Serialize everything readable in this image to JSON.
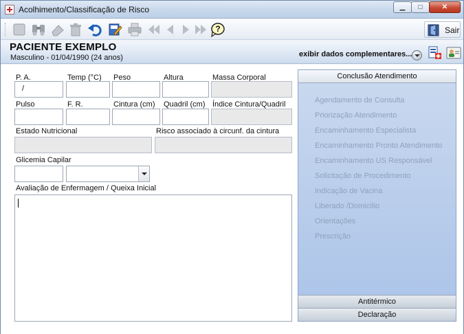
{
  "window": {
    "title": "Acolhimento/Classificação de Risco",
    "buttons": {
      "minimize": "▁",
      "maximize": "□",
      "close": "✕"
    }
  },
  "toolbar": {
    "icons": [
      "new-icon",
      "binoculars-icon",
      "eraser-icon",
      "trash-icon",
      "undo-icon",
      "edit-icon",
      "print-icon",
      "first-icon",
      "previous-icon",
      "next-icon",
      "last-icon",
      "help-icon"
    ],
    "sair_label": "Sair"
  },
  "patient": {
    "name": "PACIENTE EXEMPLO",
    "info": "Masculino - 01/04/1990 (24 anos)",
    "complementares": "exibir dados complementares..."
  },
  "form": {
    "pa": {
      "label": "P. A.",
      "value": "/"
    },
    "temp": {
      "label": "Temp (°C)",
      "value": ""
    },
    "peso": {
      "label": "Peso",
      "value": ""
    },
    "altura": {
      "label": "Altura",
      "value": ""
    },
    "massa": {
      "label": "Massa Corporal",
      "value": ""
    },
    "pulso": {
      "label": "Pulso",
      "value": ""
    },
    "fr": {
      "label": "F. R.",
      "value": ""
    },
    "cintura": {
      "label": "Cintura (cm)",
      "value": ""
    },
    "quadril": {
      "label": "Quadril (cm)",
      "value": ""
    },
    "indice": {
      "label": "Índice Cintura/Quadril",
      "value": ""
    },
    "estado": {
      "label": "Estado Nutricional",
      "value": ""
    },
    "risco": {
      "label": "Risco associado à circunf. da cintura",
      "value": ""
    },
    "glicemia": {
      "label": "Glicemia Capilar",
      "value": "",
      "select_value": ""
    },
    "avaliacao": {
      "label": "Avaliação de Enfermagem / Queixa Inicial",
      "value": ""
    }
  },
  "side_panel": {
    "header": "Conclusão Atendimento",
    "items": [
      "Agendamento de Consulta",
      "Priorização Atendimento",
      "Encaminhamento Especialista",
      "Encaminhamento Pronto Atendimento",
      "Encaminhamento US Responsável",
      "Solicitação de Procedimento",
      "Indicação de Vacina",
      "Liberado /Domicílio",
      "Orientações",
      "Prescrição"
    ],
    "footer": [
      "Antitérmico",
      "Declaração"
    ]
  },
  "colors": {
    "accent": "#aac3e8",
    "disabled_text": "#8ea2bd",
    "title_gradient": "#c9d9ec"
  }
}
